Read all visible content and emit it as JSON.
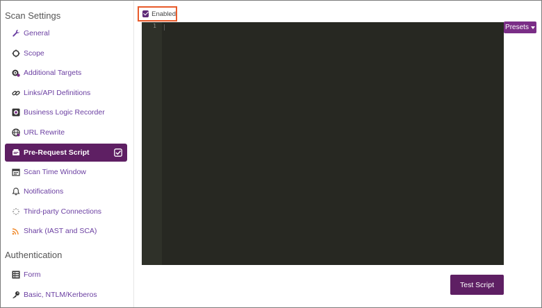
{
  "sidebar": {
    "scan_settings_title": "Scan Settings",
    "items": [
      {
        "label": "General",
        "icon": "wrench-icon"
      },
      {
        "label": "Scope",
        "icon": "scope-icon"
      },
      {
        "label": "Additional Targets",
        "icon": "targets-icon"
      },
      {
        "label": "Links/API Definitions",
        "icon": "link-icon"
      },
      {
        "label": "Business Logic Recorder",
        "icon": "record-icon"
      },
      {
        "label": "URL Rewrite",
        "icon": "globe-icon"
      },
      {
        "label": "Pre-Request Script",
        "icon": "script-icon",
        "active": true
      },
      {
        "label": "Scan Time Window",
        "icon": "calendar-icon"
      },
      {
        "label": "Notifications",
        "icon": "bell-icon"
      },
      {
        "label": "Third-party Connections",
        "icon": "connections-icon"
      },
      {
        "label": "Shark (IAST and SCA)",
        "icon": "shark-icon"
      }
    ],
    "auth_title": "Authentication",
    "auth_items": [
      {
        "label": "Form",
        "icon": "form-icon"
      },
      {
        "label": "Basic, NTLM/Kerberos",
        "icon": "key-icon"
      }
    ]
  },
  "main": {
    "enabled_label": "Enabled",
    "enabled_checked": true,
    "line_number": "1",
    "presets_label": "Presets",
    "test_script_label": "Test Script"
  },
  "colors": {
    "accent": "#5e1f63",
    "link": "#6a3ea1",
    "editor_bg": "#272822",
    "highlight": "#e85a2a"
  }
}
